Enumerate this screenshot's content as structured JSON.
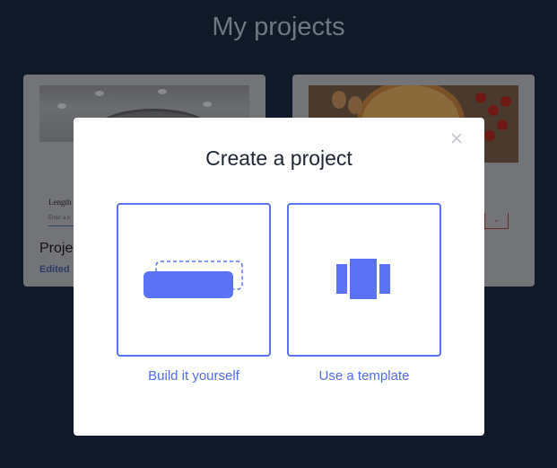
{
  "page": {
    "title": "My projects"
  },
  "cards": [
    {
      "label": "Length",
      "input_placeholder": "Enter a n",
      "name": "Proje",
      "edited": "Edited"
    },
    {
      "select_caret": "⌄"
    }
  ],
  "modal": {
    "title": "Create a project",
    "close_icon": "close-icon",
    "options": [
      {
        "label": "Build it yourself",
        "icon": "blank-canvas-icon"
      },
      {
        "label": "Use a template",
        "icon": "template-carousel-icon"
      }
    ]
  },
  "colors": {
    "accent": "#5c72f5",
    "accent_text": "#4f6cf2",
    "backdrop": "#0f1927",
    "title_text": "#1e2633"
  }
}
